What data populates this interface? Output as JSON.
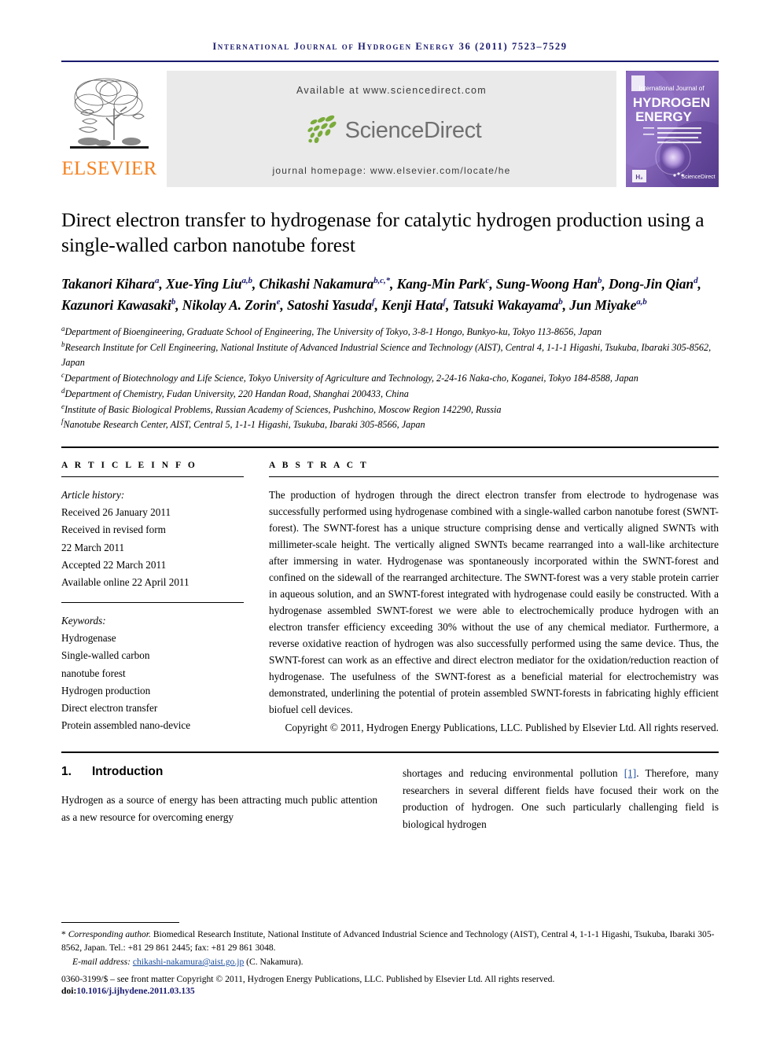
{
  "running_head": "International Journal of Hydrogen Energy 36 (2011) 7523–7529",
  "masthead": {
    "publisher_name": "ELSEVIER",
    "publisher_logo_icon": "elsevier-tree-logo",
    "available_at": "Available at www.sciencedirect.com",
    "sciencedirect_wordmark": "ScienceDirect",
    "sciencedirect_logo_icon": "sciencedirect-leaves-logo",
    "journal_homepage": "journal homepage: www.elsevier.com/locate/he",
    "cover": {
      "line1": "International Journal of",
      "line2": "HYDROGEN",
      "line3": "ENERGY",
      "badge": "H₂",
      "footer_brand": "ScienceDirect"
    }
  },
  "article": {
    "title": "Direct electron transfer to hydrogenase for catalytic hydrogen production using a single-walled carbon nanotube forest",
    "authors": [
      {
        "name": "Takanori Kihara",
        "sup": "a",
        "sep": ", "
      },
      {
        "name": "Xue-Ying Liu",
        "sup": "a,b",
        "sep": ", "
      },
      {
        "name": "Chikashi Nakamura",
        "sup": "b,c,*",
        "sep": ", "
      },
      {
        "name": "Kang-Min Park",
        "sup": "c",
        "sep": ", "
      },
      {
        "name": "Sung-Woong Han",
        "sup": "b",
        "sep": ", "
      },
      {
        "name": "Dong-Jin Qian",
        "sup": "d",
        "sep": ", "
      },
      {
        "name": "Kazunori Kawasaki",
        "sup": "b",
        "sep": ", "
      },
      {
        "name": "Nikolay A. Zorin",
        "sup": "e",
        "sep": ", "
      },
      {
        "name": "Satoshi Yasuda",
        "sup": "f",
        "sep": ", "
      },
      {
        "name": "Kenji Hata",
        "sup": "f",
        "sep": ", "
      },
      {
        "name": "Tatsuki Wakayama",
        "sup": "b",
        "sep": ", "
      },
      {
        "name": "Jun Miyake",
        "sup": "a,b",
        "sep": ""
      }
    ],
    "affiliations": [
      {
        "sup": "a",
        "text": "Department of Bioengineering, Graduate School of Engineering, The University of Tokyo, 3-8-1 Hongo, Bunkyo-ku, Tokyo 113-8656, Japan"
      },
      {
        "sup": "b",
        "text": "Research Institute for Cell Engineering, National Institute of Advanced Industrial Science and Technology (AIST), Central 4, 1-1-1 Higashi, Tsukuba, Ibaraki 305-8562, Japan"
      },
      {
        "sup": "c",
        "text": "Department of Biotechnology and Life Science, Tokyo University of Agriculture and Technology, 2-24-16 Naka-cho, Koganei, Tokyo 184-8588, Japan"
      },
      {
        "sup": "d",
        "text": "Department of Chemistry, Fudan University, 220 Handan Road, Shanghai 200433, China"
      },
      {
        "sup": "e",
        "text": "Institute of Basic Biological Problems, Russian Academy of Sciences, Pushchino, Moscow Region 142290, Russia"
      },
      {
        "sup": "f",
        "text": "Nanotube Research Center, AIST, Central 5, 1-1-1 Higashi, Tsukuba, Ibaraki 305-8566, Japan"
      }
    ]
  },
  "article_info": {
    "label": "A R T I C L E  I N F O",
    "history_head": "Article history:",
    "history": [
      "Received 26 January 2011",
      "Received in revised form",
      "22 March 2011",
      "Accepted 22 March 2011",
      "Available online 22 April 2011"
    ],
    "keywords_head": "Keywords:",
    "keywords": [
      "Hydrogenase",
      "Single-walled carbon",
      "nanotube forest",
      "Hydrogen production",
      "Direct electron transfer",
      "Protein assembled nano-device"
    ]
  },
  "abstract": {
    "label": "A B S T R A C T",
    "text": "The production of hydrogen through the direct electron transfer from electrode to hydrogenase was successfully performed using hydrogenase combined with a single-walled carbon nanotube forest (SWNT-forest). The SWNT-forest has a unique structure comprising dense and vertically aligned SWNTs with millimeter-scale height. The vertically aligned SWNTs became rearranged into a wall-like architecture after immersing in water. Hydrogenase was spontaneously incorporated within the SWNT-forest and confined on the sidewall of the rearranged architecture. The SWNT-forest was a very stable protein carrier in aqueous solution, and an SWNT-forest integrated with hydrogenase could easily be constructed. With a hydrogenase assembled SWNT-forest we were able to electrochemically produce hydrogen with an electron transfer efficiency exceeding 30% without the use of any chemical mediator. Furthermore, a reverse oxidative reaction of hydrogen was also successfully performed using the same device. Thus, the SWNT-forest can work as an effective and direct electron mediator for the oxidation/reduction reaction of hydrogenase. The usefulness of the SWNT-forest as a beneficial material for electrochemistry was demonstrated, underlining the potential of protein assembled SWNT-forests in fabricating highly efficient biofuel cell devices.",
    "copyright": "Copyright © 2011, Hydrogen Energy Publications, LLC. Published by Elsevier Ltd. All rights reserved."
  },
  "body": {
    "section_number": "1.",
    "section_title": "Introduction",
    "left_text": "Hydrogen as a source of energy has been attracting much public attention as a new resource for overcoming energy",
    "right_text_pre": "shortages and reducing environmental pollution ",
    "right_ref": "[1]",
    "right_text_post": ". Therefore, many researchers in several different fields have focused their work on the production of hydrogen. One such particularly challenging field is biological hydrogen"
  },
  "footnotes": {
    "corresponding_marker": "*",
    "corresponding_italic": "Corresponding author.",
    "corresponding_rest": " Biomedical Research Institute, National Institute of Advanced Industrial Science and Technology (AIST), Central 4, 1-1-1 Higashi, Tsukuba, Ibaraki 305-8562, Japan. Tel.: +81 29 861 2445; fax: +81 29 861 3048.",
    "email_label": "E-mail address: ",
    "email": "chikashi-nakamura@aist.go.jp",
    "email_suffix": " (C. Nakamura).",
    "issn_line": "0360-3199/$ – see front matter Copyright © 2011, Hydrogen Energy Publications, LLC. Published by Elsevier Ltd. All rights reserved.",
    "doi_prefix": "doi:",
    "doi": "10.1016/j.ijhydene.2011.03.135"
  },
  "colors": {
    "journal_navy": "#1a1a6e",
    "elsevier_orange": "#f58220",
    "sciencedirect_green": "#7aab3a",
    "sciencedirect_gray": "#707070",
    "link_blue": "#1a4b9e",
    "banner_gray": "#eaeaea"
  }
}
